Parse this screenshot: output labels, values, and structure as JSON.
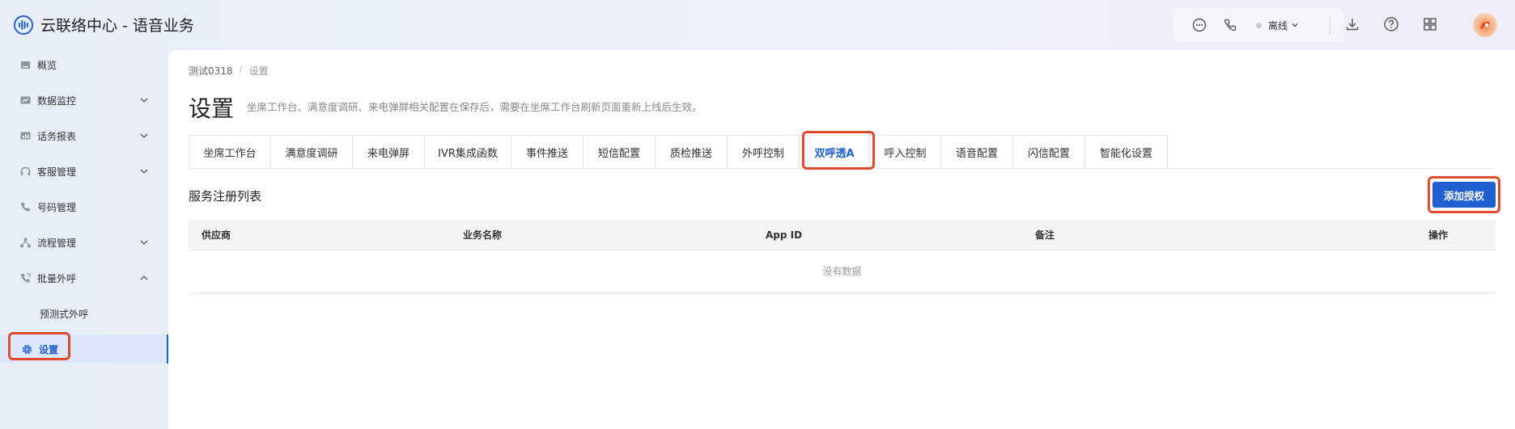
{
  "app": {
    "title": "云联络中心 - 语音业务",
    "logo_icon": "voice-wave-logo-icon"
  },
  "topbar": {
    "icons": [
      "chat-bubble-icon",
      "phone-icon",
      "download-icon",
      "help-circle-icon",
      "grid-apps-icon"
    ],
    "status_label": "离线",
    "status_color": "#c8ccd3"
  },
  "sidebar": {
    "items": [
      {
        "label": "概览",
        "icon": "overview-icon"
      },
      {
        "label": "数据监控",
        "icon": "monitor-icon",
        "expandable": true
      },
      {
        "label": "话务报表",
        "icon": "report-icon",
        "expandable": true
      },
      {
        "label": "客服管理",
        "icon": "headset-icon",
        "expandable": true
      },
      {
        "label": "号码管理",
        "icon": "phone-icon"
      },
      {
        "label": "流程管理",
        "icon": "flow-icon",
        "expandable": true
      },
      {
        "label": "批量外呼",
        "icon": "outbound-call-icon",
        "expanded": true
      },
      {
        "label": "预测式外呼",
        "sub": true
      },
      {
        "label": "设置",
        "icon": "gear-icon",
        "active": true
      }
    ]
  },
  "breadcrumb": {
    "items": [
      "测试0318",
      "设置"
    ],
    "separator": "/"
  },
  "page": {
    "title": "设置",
    "description": "坐席工作台、满意度调研、来电弹屏相关配置在保存后，需要在坐席工作台刷新页面重新上线后生效。"
  },
  "tabs": [
    {
      "label": "坐席工作台"
    },
    {
      "label": "满意度调研"
    },
    {
      "label": "来电弹屏"
    },
    {
      "label": "IVR集成函数"
    },
    {
      "label": "事件推送"
    },
    {
      "label": "短信配置"
    },
    {
      "label": "质检推送"
    },
    {
      "label": "外呼控制"
    },
    {
      "label": "双呼透A",
      "active": true
    },
    {
      "label": "呼入控制"
    },
    {
      "label": "语音配置"
    },
    {
      "label": "闪信配置"
    },
    {
      "label": "智能化设置"
    }
  ],
  "section": {
    "title": "服务注册列表",
    "add_button": "添加授权"
  },
  "table": {
    "columns": [
      "供应商",
      "业务名称",
      "App ID",
      "备注",
      "操作"
    ],
    "rows": [],
    "empty_text": "没有数据"
  },
  "colors": {
    "accent": "#1f5fd1",
    "highlight": "#e24a2f",
    "header_bg": "#f2f4f8"
  }
}
